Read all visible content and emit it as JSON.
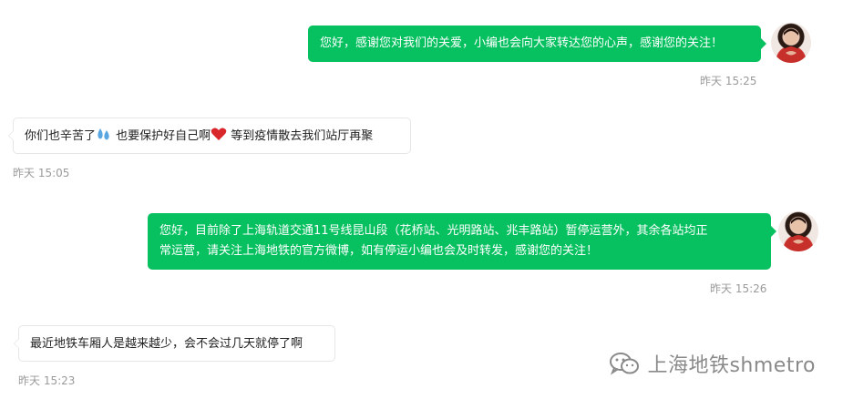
{
  "messages": [
    {
      "side": "out",
      "text": "您好，感谢您对我们的关爱，小编也会向大家转达您的心声，感谢您的关注！",
      "time": "昨天 15:25"
    },
    {
      "side": "in",
      "text_1": "你们也辛苦了",
      "text_2": " 也要保护好自己啊",
      "text_3": " 等到疫情散去我们站厅再聚",
      "time": "昨天 15:05"
    },
    {
      "side": "out",
      "line_1": "您好，目前除了上海轨道交通11号线昆山段（花桥站、光明路站、兆丰路站）暂停运营外，其余各站均正",
      "line_2": "常运营，请关注上海地铁的官方微博，如有停运小编也会及时转发，感谢您的关注！",
      "time": "昨天 15:26"
    },
    {
      "side": "in",
      "text": "最近地铁车厢人是越来越少，会不会过几天就停了啊",
      "time": "昨天 15:23"
    }
  ],
  "icons": {
    "sweat": "sweat-droplets-icon",
    "heart": "red-heart-icon",
    "wechat": "wechat-icon"
  },
  "colors": {
    "bubble_out": "#07c160",
    "bubble_in_border": "#e6e6e6",
    "time": "#9a9a9a"
  },
  "watermark": "上海地铁shmetro"
}
